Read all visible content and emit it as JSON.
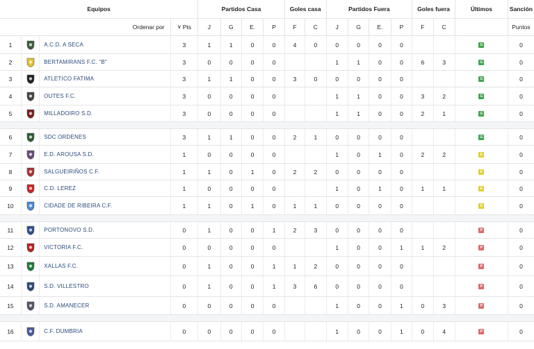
{
  "headers": {
    "equipos": "Equipos",
    "partidos_casa": "Partidos Casa",
    "goles_casa": "Goles casa",
    "partidos_fuera": "Partidos Fuera",
    "goles_fuera": "Goles fuera",
    "ultimos": "Últimos",
    "sancion": "Sanción",
    "ordenar_por": "Ordenar por",
    "pts": "Pts",
    "j": "J",
    "g": "G",
    "e": "E.",
    "p": "P",
    "f": "F",
    "c": "C",
    "puntos": "Puntos"
  },
  "colors": {
    "green": "#3aa84a",
    "yellow": "#e2cf2f",
    "red": "#e06a6a"
  },
  "rows": [
    {
      "pos": "1",
      "team": "A.C.D. A SECA",
      "pts": "3",
      "hj": "1",
      "hg": "1",
      "he": "0",
      "hp": "0",
      "hf": "4",
      "hc": "0",
      "aj": "0",
      "ag": "0",
      "ae": "0",
      "ap": "0",
      "af": "",
      "ac": "",
      "last": "G",
      "sancion": "0"
    },
    {
      "pos": "2",
      "team": "BERTAMIRANS F.C. \"B\"",
      "pts": "3",
      "hj": "0",
      "hg": "0",
      "he": "0",
      "hp": "0",
      "hf": "",
      "hc": "",
      "aj": "1",
      "ag": "1",
      "ae": "0",
      "ap": "0",
      "af": "6",
      "ac": "3",
      "last": "G",
      "sancion": "0"
    },
    {
      "pos": "3",
      "team": "ATLETICO FATIMA",
      "pts": "3",
      "hj": "1",
      "hg": "1",
      "he": "0",
      "hp": "0",
      "hf": "3",
      "hc": "0",
      "aj": "0",
      "ag": "0",
      "ae": "0",
      "ap": "0",
      "af": "",
      "ac": "",
      "last": "G",
      "sancion": "0"
    },
    {
      "pos": "4",
      "team": "OUTES F.C.",
      "pts": "3",
      "hj": "0",
      "hg": "0",
      "he": "0",
      "hp": "0",
      "hf": "",
      "hc": "",
      "aj": "1",
      "ag": "1",
      "ae": "0",
      "ap": "0",
      "af": "3",
      "ac": "2",
      "last": "G",
      "sancion": "0"
    },
    {
      "pos": "5",
      "team": "MILLADOIRO S.D.",
      "pts": "3",
      "hj": "0",
      "hg": "0",
      "he": "0",
      "hp": "0",
      "hf": "",
      "hc": "",
      "aj": "1",
      "ag": "1",
      "ae": "0",
      "ap": "0",
      "af": "2",
      "ac": "1",
      "last": "G",
      "sancion": "0"
    },
    {
      "pos": "6",
      "team": "SDC ORDENES",
      "pts": "3",
      "hj": "1",
      "hg": "1",
      "he": "0",
      "hp": "0",
      "hf": "2",
      "hc": "1",
      "aj": "0",
      "ag": "0",
      "ae": "0",
      "ap": "0",
      "af": "",
      "ac": "",
      "last": "G",
      "sancion": "0"
    },
    {
      "pos": "7",
      "team": "E.D. AROUSA S.D.",
      "pts": "1",
      "hj": "0",
      "hg": "0",
      "he": "0",
      "hp": "0",
      "hf": "",
      "hc": "",
      "aj": "1",
      "ag": "0",
      "ae": "1",
      "ap": "0",
      "af": "2",
      "ac": "2",
      "last": "E",
      "sancion": "0"
    },
    {
      "pos": "8",
      "team": "SALGUEIRIÑOS C.F.",
      "pts": "1",
      "hj": "1",
      "hg": "0",
      "he": "1",
      "hp": "0",
      "hf": "2",
      "hc": "2",
      "aj": "0",
      "ag": "0",
      "ae": "0",
      "ap": "0",
      "af": "",
      "ac": "",
      "last": "E",
      "sancion": "0"
    },
    {
      "pos": "9",
      "team": "C.D. LEREZ",
      "pts": "1",
      "hj": "0",
      "hg": "0",
      "he": "0",
      "hp": "0",
      "hf": "",
      "hc": "",
      "aj": "1",
      "ag": "0",
      "ae": "1",
      "ap": "0",
      "af": "1",
      "ac": "1",
      "last": "E",
      "sancion": "0"
    },
    {
      "pos": "10",
      "team": "CIDADE DE RIBEIRA C.F.",
      "pts": "1",
      "hj": "1",
      "hg": "0",
      "he": "1",
      "hp": "0",
      "hf": "1",
      "hc": "1",
      "aj": "0",
      "ag": "0",
      "ae": "0",
      "ap": "0",
      "af": "",
      "ac": "",
      "last": "E",
      "sancion": "0"
    },
    {
      "pos": "11",
      "team": "PORTONOVO S.D.",
      "pts": "0",
      "hj": "1",
      "hg": "0",
      "he": "0",
      "hp": "1",
      "hf": "2",
      "hc": "3",
      "aj": "0",
      "ag": "0",
      "ae": "0",
      "ap": "0",
      "af": "",
      "ac": "",
      "last": "P",
      "sancion": "0"
    },
    {
      "pos": "12",
      "team": "VICTORIA F.C.",
      "pts": "0",
      "hj": "0",
      "hg": "0",
      "he": "0",
      "hp": "0",
      "hf": "",
      "hc": "",
      "aj": "1",
      "ag": "0",
      "ae": "0",
      "ap": "1",
      "af": "1",
      "ac": "2",
      "last": "P",
      "sancion": "0"
    },
    {
      "pos": "13",
      "team": "XALLAS F.C.",
      "pts": "0",
      "hj": "1",
      "hg": "0",
      "he": "0",
      "hp": "1",
      "hf": "1",
      "hc": "2",
      "aj": "0",
      "ag": "0",
      "ae": "0",
      "ap": "0",
      "af": "",
      "ac": "",
      "last": "P",
      "sancion": "0"
    },
    {
      "pos": "14",
      "team": "S.D. VILLESTRO",
      "pts": "0",
      "hj": "1",
      "hg": "0",
      "he": "0",
      "hp": "1",
      "hf": "3",
      "hc": "6",
      "aj": "0",
      "ag": "0",
      "ae": "0",
      "ap": "0",
      "af": "",
      "ac": "",
      "last": "P",
      "sancion": "0"
    },
    {
      "pos": "15",
      "team": "S.D. AMANECER",
      "pts": "0",
      "hj": "0",
      "hg": "0",
      "he": "0",
      "hp": "0",
      "hf": "",
      "hc": "",
      "aj": "1",
      "ag": "0",
      "ae": "0",
      "ap": "1",
      "af": "0",
      "ac": "3",
      "last": "P",
      "sancion": "0"
    },
    {
      "pos": "16",
      "team": "C.F. DUMBRIA",
      "pts": "0",
      "hj": "0",
      "hg": "0",
      "he": "0",
      "hp": "0",
      "hf": "",
      "hc": "",
      "aj": "1",
      "ag": "0",
      "ae": "0",
      "ap": "1",
      "af": "0",
      "ac": "4",
      "last": "P",
      "sancion": "0"
    }
  ],
  "crests": [
    "crest-1",
    "crest-2",
    "crest-3",
    "crest-4",
    "crest-5",
    "crest-6",
    "crest-7",
    "crest-8",
    "crest-9",
    "crest-10",
    "crest-11",
    "crest-12",
    "crest-13",
    "crest-14",
    "crest-15",
    "crest-16"
  ]
}
